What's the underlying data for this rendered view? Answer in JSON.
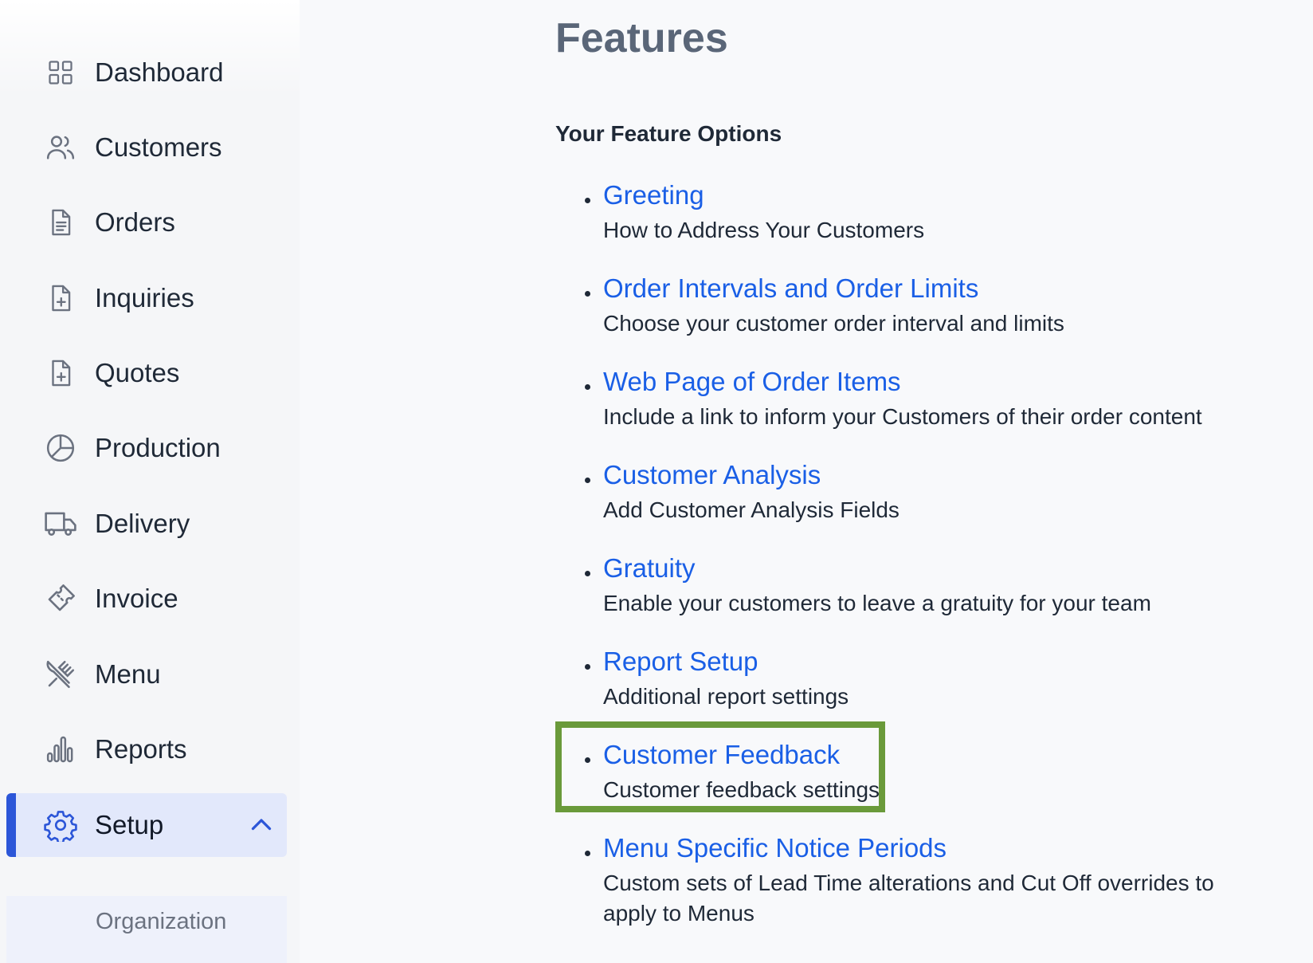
{
  "sidebar": {
    "items": [
      {
        "label": "Dashboard",
        "icon": "grid-icon"
      },
      {
        "label": "Customers",
        "icon": "users-icon"
      },
      {
        "label": "Orders",
        "icon": "document-icon"
      },
      {
        "label": "Inquiries",
        "icon": "document-plus-icon"
      },
      {
        "label": "Quotes",
        "icon": "document-plus-icon"
      },
      {
        "label": "Production",
        "icon": "pie-chart-icon"
      },
      {
        "label": "Delivery",
        "icon": "truck-icon"
      },
      {
        "label": "Invoice",
        "icon": "ticket-icon"
      },
      {
        "label": "Menu",
        "icon": "utensils-icon"
      },
      {
        "label": "Reports",
        "icon": "bar-chart-icon"
      },
      {
        "label": "Setup",
        "icon": "gear-icon",
        "active": true,
        "expanded": true
      }
    ],
    "subitems": [
      {
        "label": "Organization"
      }
    ],
    "active_color": "#2c56d8"
  },
  "main": {
    "title": "Features",
    "section_title": "Your Feature Options",
    "features": [
      {
        "title": "Greeting",
        "description": "How to Address Your Customers"
      },
      {
        "title": "Order Intervals and Order Limits",
        "description": "Choose your customer order interval and limits"
      },
      {
        "title": "Web Page of Order Items",
        "description": "Include a link to inform your Customers of their order content"
      },
      {
        "title": "Customer Analysis",
        "description": "Add Customer Analysis Fields"
      },
      {
        "title": "Gratuity",
        "description": "Enable your customers to leave a gratuity for your team"
      },
      {
        "title": "Report Setup",
        "description": "Additional report settings"
      },
      {
        "title": "Customer Feedback",
        "description": "Customer feedback settings",
        "highlighted": true
      },
      {
        "title": "Menu Specific Notice Periods",
        "description": "Custom sets of Lead Time alterations and Cut Off overrides to apply to Menus"
      }
    ],
    "link_color": "#1a5fe6",
    "highlight_color": "#6a9a3a"
  }
}
